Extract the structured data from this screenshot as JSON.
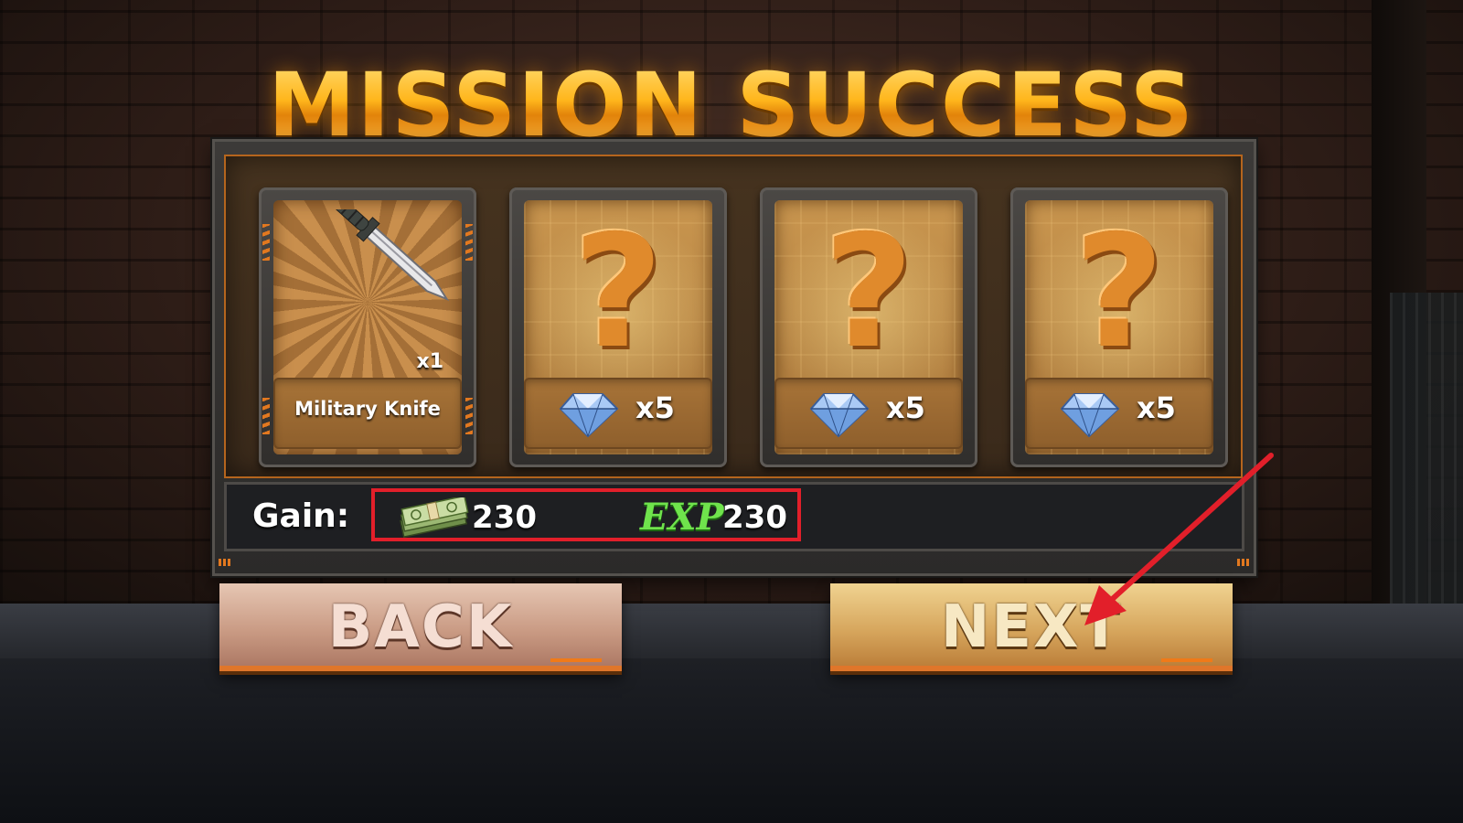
{
  "title": "MISSION SUCCESS",
  "rewards": [
    {
      "type": "item",
      "name": "Military Knife",
      "quantity": "x1",
      "icon": "knife-icon"
    },
    {
      "type": "mystery",
      "icon": "question-mark-icon",
      "bonus_icon": "diamond-icon",
      "bonus_quantity": "x5"
    },
    {
      "type": "mystery",
      "icon": "question-mark-icon",
      "bonus_icon": "diamond-icon",
      "bonus_quantity": "x5"
    },
    {
      "type": "mystery",
      "icon": "question-mark-icon",
      "bonus_icon": "diamond-icon",
      "bonus_quantity": "x5"
    }
  ],
  "gain": {
    "label": "Gain:",
    "money_icon": "cash-stack-icon",
    "money": "230",
    "exp_label": "EXP",
    "exp": "230"
  },
  "buttons": {
    "back": "BACK",
    "next": "NEXT"
  },
  "colors": {
    "title_gold": "#ffb61c",
    "highlight_box": "#e21f2a",
    "exp_green": "#6fe34c",
    "panel_orange": "#b5651d"
  },
  "annotation": {
    "type": "arrow",
    "color": "#e21f2a",
    "points_to": "next-button"
  }
}
